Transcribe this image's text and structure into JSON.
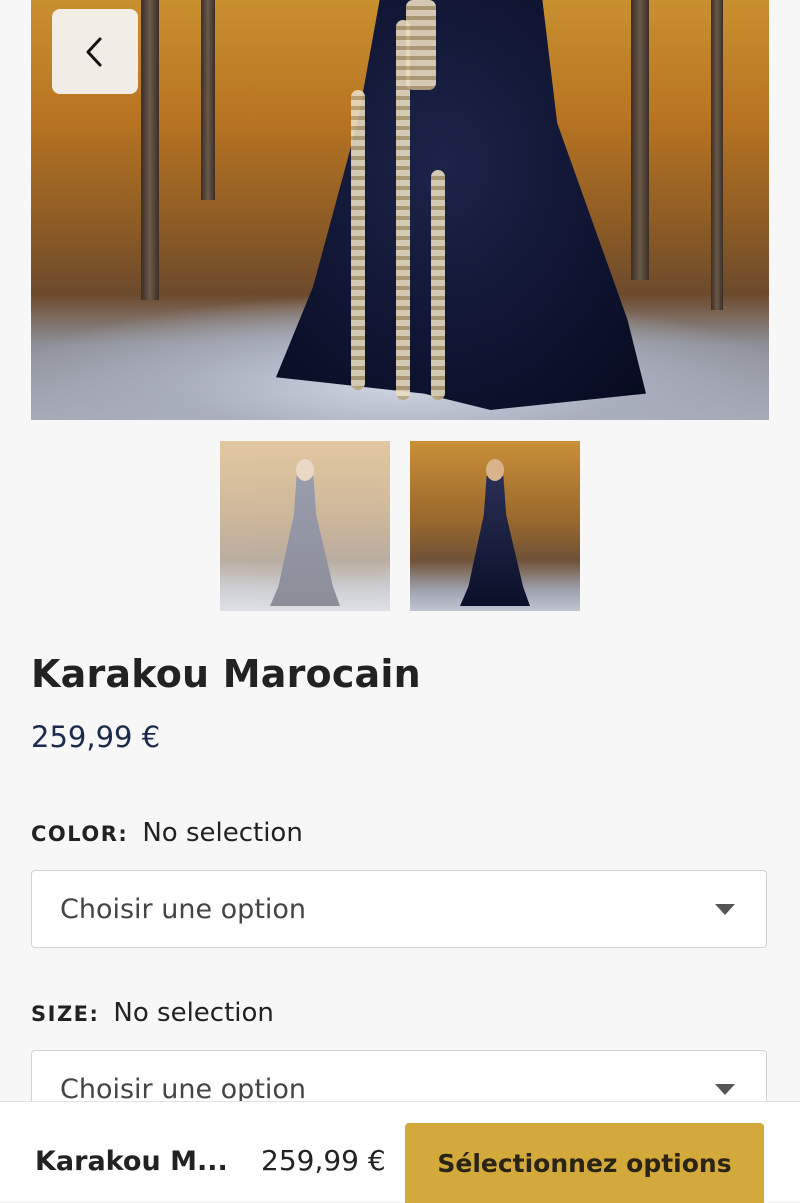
{
  "product": {
    "title": "Karakou Marocain",
    "price": "259,99 €"
  },
  "options": {
    "color": {
      "label": "COLOR:",
      "status": "No selection",
      "select_value": "Choisir une option"
    },
    "size": {
      "label": "SIZE:",
      "status": "No selection",
      "select_value": "Choisir une option"
    }
  },
  "bottom_bar": {
    "name": "Karakou M...",
    "price": "259,99 €",
    "button_label": "Sélectionnez options",
    "button_color": "#d3a93c"
  },
  "icons": {
    "back": "chevron-left-icon",
    "dropdown": "caret-down-icon"
  },
  "colors": {
    "price": "#1c2a4d",
    "background": "#f7f7f7"
  }
}
